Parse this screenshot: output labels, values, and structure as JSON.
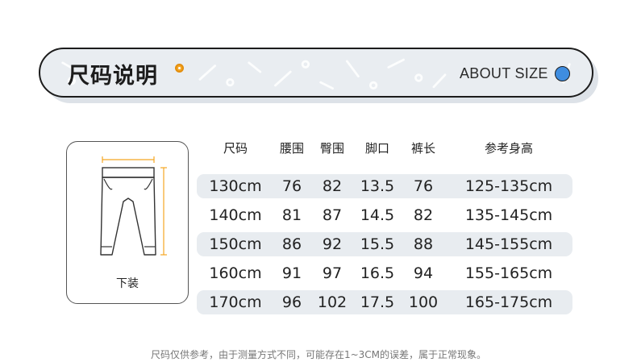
{
  "header": {
    "title": "尺码说明",
    "subtitle": "ABOUT SIZE",
    "accent_orange": "#f5a623",
    "accent_blue": "#3f8de0"
  },
  "garment": {
    "label": "下装",
    "icon": "pants-icon",
    "measure_color": "#f5a623"
  },
  "table": {
    "headers": [
      "尺码",
      "腰围",
      "臀围",
      "脚口",
      "裤长",
      "参考身高"
    ],
    "rows": [
      [
        "130cm",
        "76",
        "82",
        "13.5",
        "76",
        "125-135cm"
      ],
      [
        "140cm",
        "81",
        "87",
        "14.5",
        "82",
        "135-145cm"
      ],
      [
        "150cm",
        "86",
        "92",
        "15.5",
        "88",
        "145-155cm"
      ],
      [
        "160cm",
        "91",
        "97",
        "16.5",
        "94",
        "155-165cm"
      ],
      [
        "170cm",
        "96",
        "102",
        "17.5",
        "100",
        "165-175cm"
      ]
    ],
    "row_bg": "#e8ecf0"
  },
  "footnote": "尺码仅供参考，由于测量方式不同，可能存在1~3CM的误差，属于正常现象。"
}
